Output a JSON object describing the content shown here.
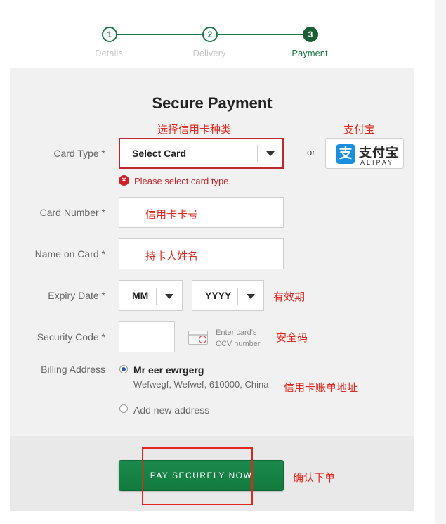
{
  "steps": [
    {
      "number": "1",
      "label": "Details"
    },
    {
      "number": "2",
      "label": "Delivery"
    },
    {
      "number": "3",
      "label": "Payment"
    }
  ],
  "title": "Secure Payment",
  "annotations": {
    "card_type_hint": "选择信用卡种类",
    "alipay_hint": "支付宝",
    "card_number_hint": "信用卡卡号",
    "name_hint": "持卡人姓名",
    "expiry_hint": "有效期",
    "security_hint": "安全码",
    "billing_hint": "信用卡账单地址",
    "pay_hint": "确认下单"
  },
  "form": {
    "card_type_label": "Card Type *",
    "card_type_value": "Select Card",
    "card_type_error": "Please select card type.",
    "error_icon": "×",
    "or_text": "or",
    "card_number_label": "Card Number *",
    "name_label": "Name on Card *",
    "expiry_label": "Expiry Date *",
    "expiry_month": "MM",
    "expiry_year": "YYYY",
    "security_label": "Security Code *",
    "ccv_hint": "Enter card's CCV number",
    "billing_label": "Billing Address",
    "address_name": "Mr eer ewrgerg",
    "address_line": "Wefwegf, Wefwef, 610000, China",
    "add_new_address": "Add new address"
  },
  "alipay": {
    "logo_char": "支",
    "name_cn": "支付宝",
    "name_en": "ALIPAY",
    "brand_color": "#1a8fe0"
  },
  "pay_button": "PAY SECURELY NOW",
  "colors": {
    "accent": "#1a7a45",
    "error": "#c0272d",
    "annotation": "#e0281e"
  },
  "icons": {
    "error": "error-icon",
    "dropdown": "chevron-down-icon",
    "card": "credit-card-icon"
  }
}
